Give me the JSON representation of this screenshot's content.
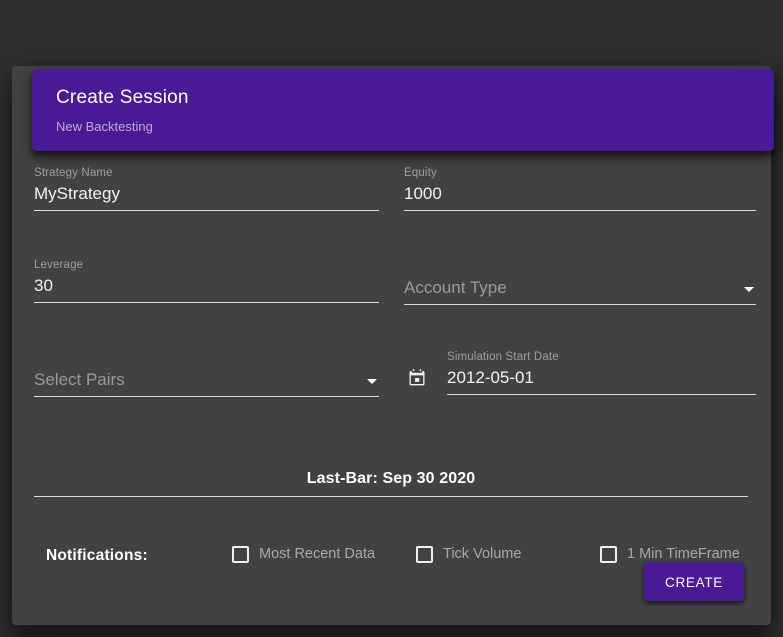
{
  "header": {
    "title": "Create Session",
    "subtitle": "New Backtesting",
    "color": "#4a1a96"
  },
  "fields": {
    "strategy_name": {
      "label": "Strategy Name",
      "value": "MyStrategy"
    },
    "equity": {
      "label": "Equity",
      "value": "1000"
    },
    "leverage": {
      "label": "Leverage",
      "value": "30"
    },
    "account_type": {
      "placeholder": "Account Type",
      "value": "",
      "icon": "chevron-down-icon"
    },
    "select_pairs": {
      "placeholder": "Select Pairs",
      "value": "",
      "icon": "chevron-down-icon"
    },
    "simulation_start_date": {
      "label": "Simulation Start Date",
      "value": "2012-05-01",
      "icon": "calendar-icon"
    }
  },
  "last_bar": {
    "text": "Last-Bar: Sep 30 2020"
  },
  "notifications": {
    "title": "Notifications:",
    "options": [
      {
        "label": "Most Recent Data",
        "checked": false
      },
      {
        "label": "Tick Volume",
        "checked": false
      },
      {
        "label": "1 Min TimeFrame",
        "checked": false
      }
    ]
  },
  "actions": {
    "create_label": "CREATE"
  },
  "theme": {
    "surface": "#424242",
    "background": "#303030",
    "accent": "#4a1a96",
    "text_primary": "#f2f2f2",
    "text_secondary": "#9e9e9e"
  }
}
